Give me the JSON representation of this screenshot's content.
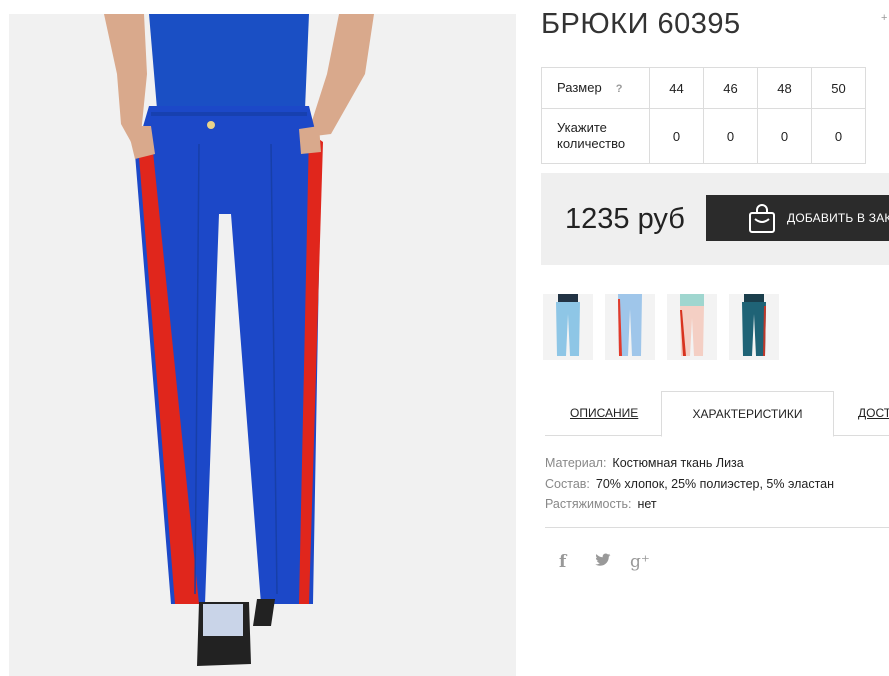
{
  "product": {
    "title": "БРЮКИ 60395",
    "corner_mark": "+"
  },
  "size_table": {
    "size_label": "Размер",
    "help_icon": "?",
    "sizes": [
      "44",
      "46",
      "48",
      "50"
    ],
    "qty_label": "Укажите количество",
    "quantities": [
      "0",
      "0",
      "0",
      "0"
    ]
  },
  "purchase": {
    "price": "1235 руб",
    "add_button": "ДОБАВИТЬ В ЗАКАЗ",
    "icon": "shopping-bag-icon"
  },
  "color_variants": [
    {
      "name": "light-blue",
      "pants": "#8ec6e6",
      "stripe": "#7fb6d8",
      "top": "#223344"
    },
    {
      "name": "sky",
      "pants": "#9fc6ea",
      "stripe": "#e23a2b",
      "top": "#9fc6ea"
    },
    {
      "name": "peach",
      "pants": "#f4cfc4",
      "stripe": "#d8331f",
      "top": "#9fd6cf"
    },
    {
      "name": "teal",
      "pants": "#1f6376",
      "stripe": "#c0392b",
      "top": "#1a3e4c"
    }
  ],
  "tabs": [
    {
      "label": "ОПИСАНИЕ",
      "active": false
    },
    {
      "label": "ХАРАКТЕРИСТИКИ",
      "active": true
    },
    {
      "label": "ДОСТАВКА",
      "active": false
    }
  ],
  "specs": [
    {
      "key": "Материал:",
      "value": "Костюмная ткань Лиза"
    },
    {
      "key": "Состав:",
      "value": "70% хлопок, 25% полиэстер, 5% эластан"
    },
    {
      "key": "Растяжимость:",
      "value": "нет"
    }
  ],
  "social": {
    "facebook": "f",
    "twitter": "🐦",
    "google_plus": "g⁺"
  },
  "colors": {
    "pants": "#1c48c8",
    "stripe": "#e0261c",
    "top": "#1a4fc4",
    "button": "#2b2b2b",
    "price_bg": "#efefef"
  }
}
